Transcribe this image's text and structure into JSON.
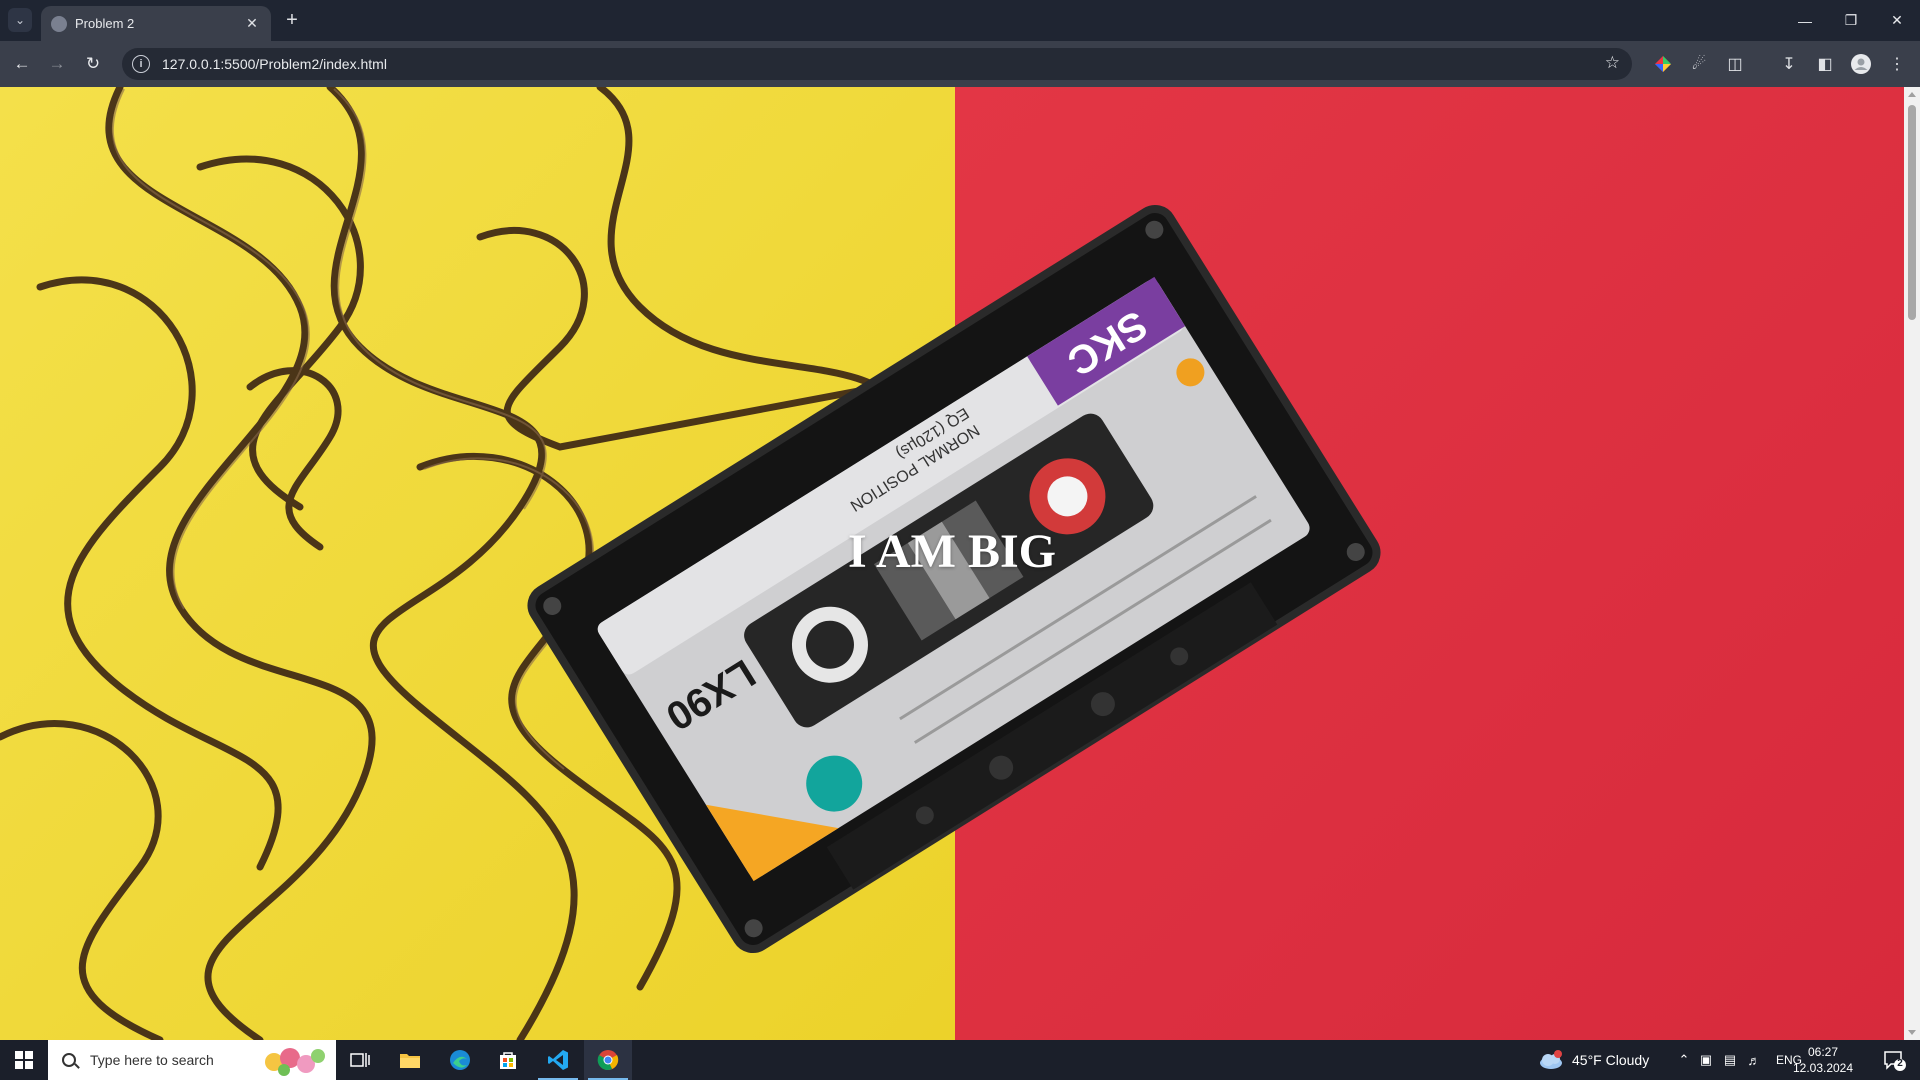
{
  "browser": {
    "tab_title": "Problem 2",
    "url": "127.0.0.1:5500/Problem2/index.html"
  },
  "page": {
    "heading": "I AM BIG",
    "background": {
      "left_color": "#f2dd3a",
      "right_color": "#e02d40",
      "subject": "cassette tape with unspooled ribbon"
    },
    "cassette": {
      "label_text": "LX90",
      "brand": "SKC",
      "subtext_1": "NORMAL POSITION",
      "subtext_2": "EQ (120µs)"
    }
  },
  "taskbar": {
    "search_placeholder": "Type here to search",
    "weather": "45°F  Cloudy",
    "language": "ENG",
    "time": "06:27",
    "date": "12.03.2024",
    "notification_count": "2",
    "weather_badge": "1"
  },
  "colors": {
    "chrome_dark": "#1f2532",
    "chrome_toolbar": "#3a3f4b",
    "taskbar": "#1b1f2a",
    "accent": "#76b9ed"
  }
}
